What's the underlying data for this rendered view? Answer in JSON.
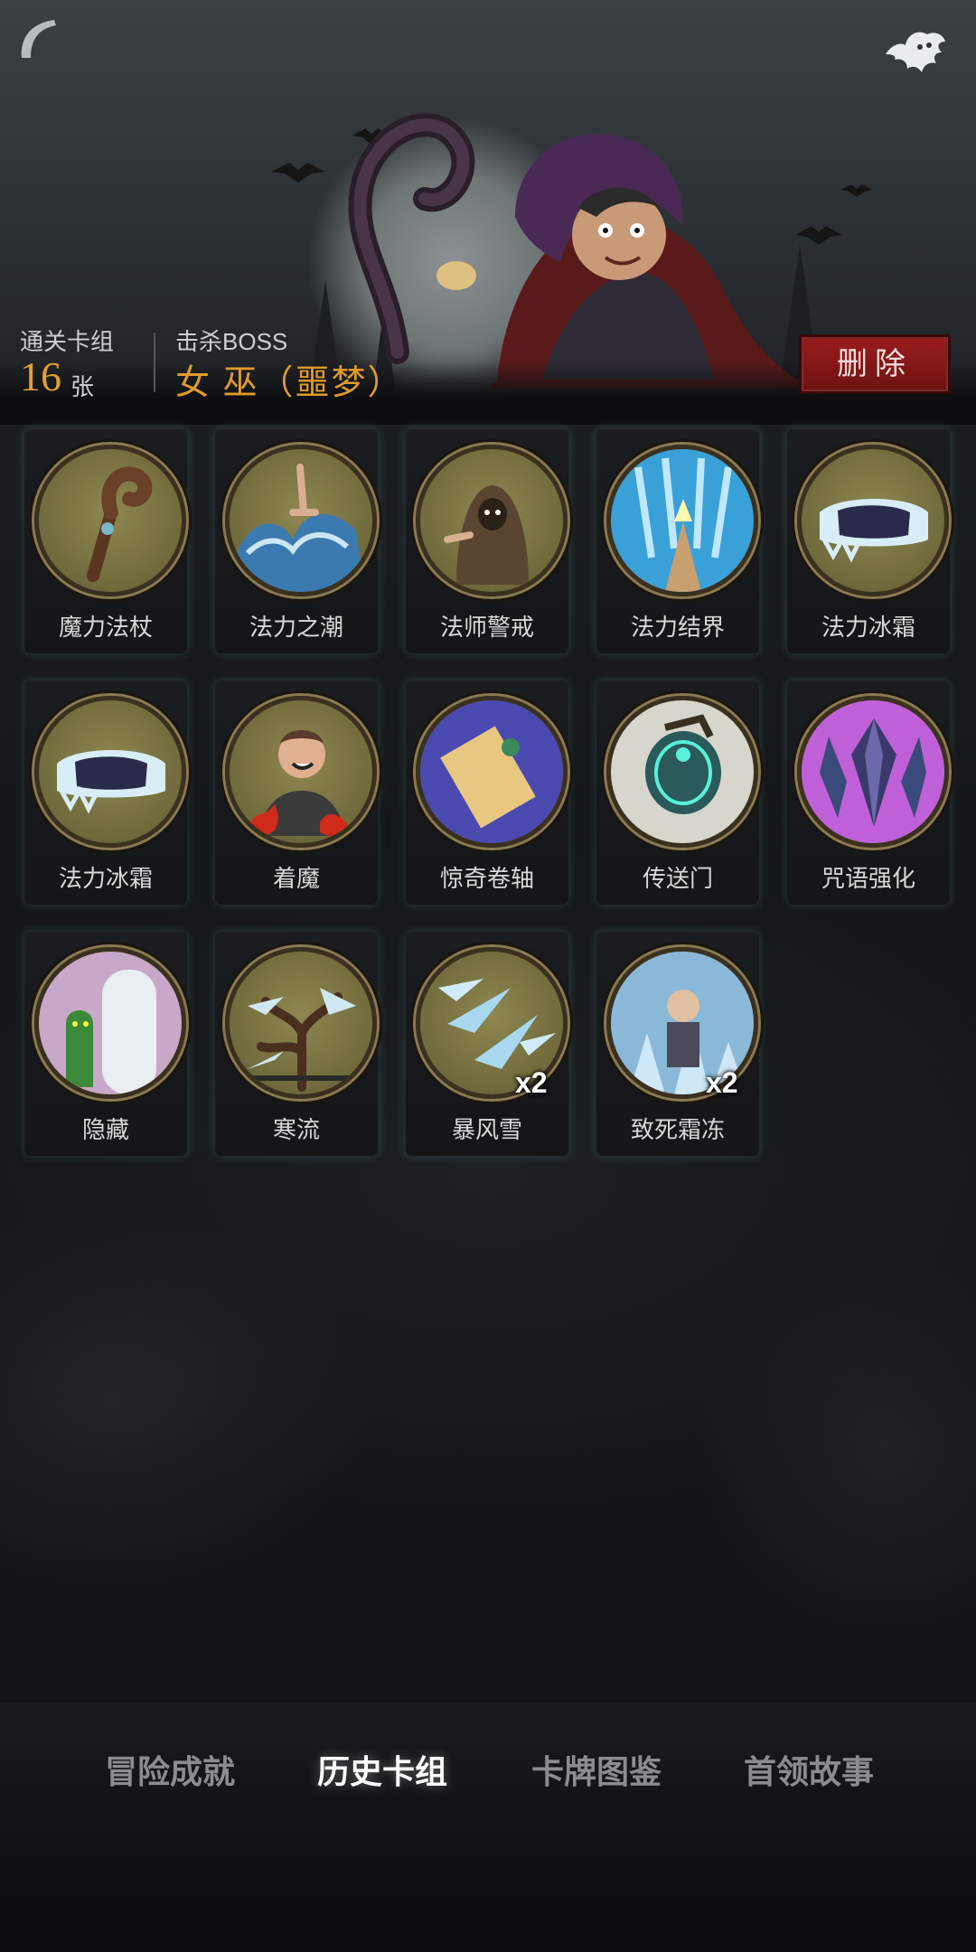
{
  "header": {
    "deck_label": "通关卡组",
    "deck_count": "16",
    "deck_unit": "张",
    "boss_label": "击杀BOSS",
    "boss_name": "女 巫（噩梦）",
    "delete_label": "删除"
  },
  "cards": [
    {
      "name": "魔力法杖",
      "icon": "staff-icon",
      "count": ""
    },
    {
      "name": "法力之潮",
      "icon": "water-tide-icon",
      "count": ""
    },
    {
      "name": "法师警戒",
      "icon": "hooded-mage-icon",
      "count": ""
    },
    {
      "name": "法力结界",
      "icon": "barrier-hand-icon",
      "count": ""
    },
    {
      "name": "法力冰霜",
      "icon": "frost-glove-icon",
      "count": ""
    },
    {
      "name": "法力冰霜",
      "icon": "frost-glove-icon",
      "count": ""
    },
    {
      "name": "着魔",
      "icon": "possessed-man-icon",
      "count": ""
    },
    {
      "name": "惊奇卷轴",
      "icon": "scroll-icon",
      "count": ""
    },
    {
      "name": "传送门",
      "icon": "portal-icon",
      "count": ""
    },
    {
      "name": "咒语强化",
      "icon": "crystal-icon",
      "count": ""
    },
    {
      "name": "隐藏",
      "icon": "door-goblin-icon",
      "count": ""
    },
    {
      "name": "寒流",
      "icon": "cold-tree-icon",
      "count": ""
    },
    {
      "name": "暴风雪",
      "icon": "ice-shards-icon",
      "count": "x2"
    },
    {
      "name": "致死霜冻",
      "icon": "frozen-man-icon",
      "count": "x2"
    }
  ],
  "nav": {
    "items": [
      {
        "label": "冒险成就",
        "active": false
      },
      {
        "label": "历史卡组",
        "active": true
      },
      {
        "label": "卡牌图鉴",
        "active": false
      },
      {
        "label": "首领故事",
        "active": false
      }
    ]
  },
  "colors": {
    "accent_gold": "#e09a2c",
    "delete_red": "#8a1a1a",
    "medal_olive": "#7d7644"
  }
}
